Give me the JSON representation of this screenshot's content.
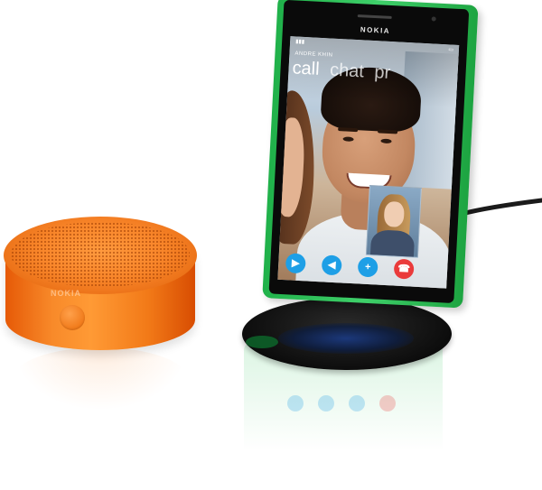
{
  "speaker": {
    "brand": "NOKIA"
  },
  "phone": {
    "brand": "NOKIA",
    "caller_name": "ANDRE KHIN",
    "pivots": [
      "call",
      "chat",
      "pr"
    ],
    "controls": [
      {
        "name": "video",
        "icon": "video-camera-icon",
        "glyph": "▶"
      },
      {
        "name": "speaker",
        "icon": "speaker-volume-icon",
        "glyph": "◀"
      },
      {
        "name": "add",
        "icon": "plus-icon",
        "glyph": "+"
      },
      {
        "name": "end-call",
        "icon": "hang-up-icon",
        "glyph": "☎"
      }
    ]
  },
  "colors": {
    "phone_green": "#2ec85a",
    "speaker_orange": "#f6832a",
    "dock_black": "#111111",
    "call_blue": "#1e9fe6",
    "end_red": "#ea3b3b"
  }
}
